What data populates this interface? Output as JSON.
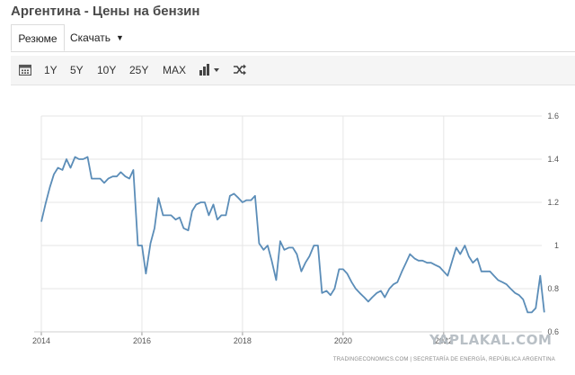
{
  "page": {
    "title": "Аргентина - Цены на бензин"
  },
  "tabs": [
    {
      "label": "Резюме"
    },
    {
      "label": "Скачать"
    }
  ],
  "toolbar": {
    "ranges": [
      "1Y",
      "5Y",
      "10Y",
      "25Y",
      "MAX"
    ],
    "icons": [
      "calendar-icon",
      "bar-chart-icon",
      "shuffle-icon"
    ]
  },
  "credit": "TRADINGECONOMICS.COM  |  SECRETARÍA DE ENERGÍA, REPÚBLICA ARGENTINA",
  "watermark": "YAPLAKAL.COM",
  "colors": {
    "line": "#5b8db8",
    "grid": "#e6e6e6",
    "toolbar_bg": "#f5f5f5"
  },
  "chart_data": {
    "type": "line",
    "title": "",
    "xlabel": "",
    "ylabel": "",
    "xlim": [
      2014,
      2023.95
    ],
    "ylim": [
      0.6,
      1.6
    ],
    "yticks": [
      "1.6",
      "1.4",
      "1.2",
      "1",
      "0.8",
      "0.6"
    ],
    "xticks": [
      "2014",
      "2016",
      "2018",
      "2020",
      "2022"
    ],
    "grid": true,
    "series": [
      {
        "name": "",
        "points": [
          [
            2014.0,
            1.11
          ],
          [
            2014.08,
            1.19
          ],
          [
            2014.17,
            1.27
          ],
          [
            2014.25,
            1.33
          ],
          [
            2014.33,
            1.36
          ],
          [
            2014.42,
            1.35
          ],
          [
            2014.5,
            1.4
          ],
          [
            2014.58,
            1.36
          ],
          [
            2014.67,
            1.41
          ],
          [
            2014.75,
            1.4
          ],
          [
            2014.83,
            1.4
          ],
          [
            2014.92,
            1.41
          ],
          [
            2015.0,
            1.31
          ],
          [
            2015.08,
            1.31
          ],
          [
            2015.17,
            1.31
          ],
          [
            2015.25,
            1.29
          ],
          [
            2015.33,
            1.31
          ],
          [
            2015.42,
            1.32
          ],
          [
            2015.5,
            1.32
          ],
          [
            2015.58,
            1.34
          ],
          [
            2015.67,
            1.32
          ],
          [
            2015.75,
            1.31
          ],
          [
            2015.83,
            1.35
          ],
          [
            2015.92,
            1.0
          ],
          [
            2016.0,
            1.0
          ],
          [
            2016.08,
            0.87
          ],
          [
            2016.17,
            1.01
          ],
          [
            2016.25,
            1.08
          ],
          [
            2016.33,
            1.22
          ],
          [
            2016.42,
            1.14
          ],
          [
            2016.5,
            1.14
          ],
          [
            2016.58,
            1.14
          ],
          [
            2016.67,
            1.12
          ],
          [
            2016.75,
            1.13
          ],
          [
            2016.83,
            1.08
          ],
          [
            2016.92,
            1.07
          ],
          [
            2017.0,
            1.16
          ],
          [
            2017.08,
            1.19
          ],
          [
            2017.17,
            1.2
          ],
          [
            2017.25,
            1.2
          ],
          [
            2017.33,
            1.14
          ],
          [
            2017.42,
            1.19
          ],
          [
            2017.5,
            1.12
          ],
          [
            2017.58,
            1.14
          ],
          [
            2017.67,
            1.14
          ],
          [
            2017.75,
            1.23
          ],
          [
            2017.83,
            1.24
          ],
          [
            2017.92,
            1.22
          ],
          [
            2018.0,
            1.2
          ],
          [
            2018.08,
            1.21
          ],
          [
            2018.17,
            1.21
          ],
          [
            2018.25,
            1.23
          ],
          [
            2018.33,
            1.01
          ],
          [
            2018.42,
            0.98
          ],
          [
            2018.5,
            1.0
          ],
          [
            2018.58,
            0.93
          ],
          [
            2018.67,
            0.84
          ],
          [
            2018.75,
            1.02
          ],
          [
            2018.83,
            0.98
          ],
          [
            2018.92,
            0.99
          ],
          [
            2019.0,
            0.99
          ],
          [
            2019.08,
            0.96
          ],
          [
            2019.17,
            0.88
          ],
          [
            2019.25,
            0.92
          ],
          [
            2019.33,
            0.95
          ],
          [
            2019.42,
            1.0
          ],
          [
            2019.5,
            1.0
          ],
          [
            2019.58,
            0.78
          ],
          [
            2019.67,
            0.79
          ],
          [
            2019.75,
            0.77
          ],
          [
            2019.83,
            0.8
          ],
          [
            2019.92,
            0.89
          ],
          [
            2020.0,
            0.89
          ],
          [
            2020.08,
            0.87
          ],
          [
            2020.17,
            0.83
          ],
          [
            2020.25,
            0.8
          ],
          [
            2020.33,
            0.78
          ],
          [
            2020.42,
            0.76
          ],
          [
            2020.5,
            0.74
          ],
          [
            2020.58,
            0.76
          ],
          [
            2020.67,
            0.78
          ],
          [
            2020.75,
            0.79
          ],
          [
            2020.83,
            0.76
          ],
          [
            2020.92,
            0.8
          ],
          [
            2021.0,
            0.82
          ],
          [
            2021.08,
            0.83
          ],
          [
            2021.17,
            0.88
          ],
          [
            2021.25,
            0.92
          ],
          [
            2021.33,
            0.96
          ],
          [
            2021.42,
            0.94
          ],
          [
            2021.5,
            0.93
          ],
          [
            2021.58,
            0.93
          ],
          [
            2021.67,
            0.92
          ],
          [
            2021.75,
            0.92
          ],
          [
            2021.83,
            0.91
          ],
          [
            2021.92,
            0.9
          ],
          [
            2022.0,
            0.88
          ],
          [
            2022.08,
            0.86
          ],
          [
            2022.17,
            0.93
          ],
          [
            2022.25,
            0.99
          ],
          [
            2022.33,
            0.96
          ],
          [
            2022.42,
            1.0
          ],
          [
            2022.5,
            0.95
          ],
          [
            2022.58,
            0.92
          ],
          [
            2022.67,
            0.94
          ],
          [
            2022.75,
            0.88
          ],
          [
            2022.83,
            0.88
          ],
          [
            2022.92,
            0.88
          ],
          [
            2023.0,
            0.86
          ],
          [
            2023.08,
            0.84
          ],
          [
            2023.17,
            0.83
          ],
          [
            2023.25,
            0.82
          ],
          [
            2023.33,
            0.8
          ],
          [
            2023.42,
            0.78
          ],
          [
            2023.5,
            0.77
          ],
          [
            2023.58,
            0.75
          ],
          [
            2023.67,
            0.69
          ],
          [
            2023.75,
            0.69
          ],
          [
            2023.83,
            0.71
          ],
          [
            2023.92,
            0.86
          ],
          [
            2024.0,
            0.69
          ]
        ]
      }
    ]
  }
}
